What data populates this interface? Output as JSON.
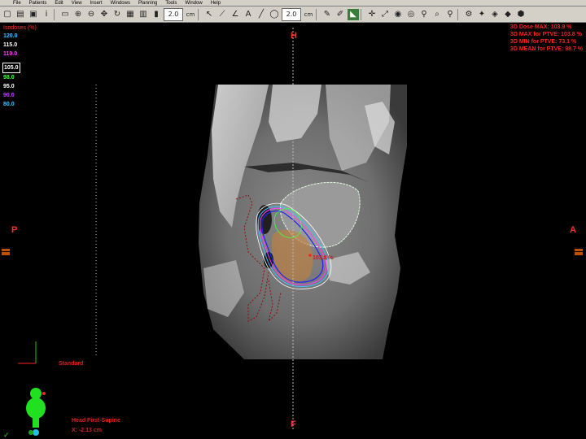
{
  "menu": [
    "File",
    "Patients",
    "Edit",
    "View",
    "Insert",
    "Windows",
    "Planning",
    "Tools",
    "Window",
    "Help"
  ],
  "toolbar": {
    "zoom_value_1": "2.0",
    "zoom_value_2": "2.0",
    "unit_1": "cm",
    "unit_2": "cm"
  },
  "isodose": {
    "title": "Isodoses (%)",
    "levels": [
      {
        "value": "120.0",
        "color": "#40c0ff"
      },
      {
        "value": "115.0",
        "color": "#ffffff"
      },
      {
        "value": "110.0",
        "color": "#ff40ff"
      },
      {
        "value": "105.0",
        "color": "#ffffff"
      },
      {
        "value": "98.0",
        "color": "#40ff40"
      },
      {
        "value": "95.0",
        "color": "#ffffff"
      },
      {
        "value": "90.0",
        "color": "#c040ff"
      },
      {
        "value": "80.0",
        "color": "#40c0ff"
      }
    ]
  },
  "dose_stats": [
    "3D Dose MAX: 103.9 %",
    "3D MAX for PTVE: 103.8 %",
    "3D MIN for PTVE: 73.1 %",
    "3D MEAN for PTVE: 98.7 %"
  ],
  "orientation": {
    "top": "H",
    "bottom": "F",
    "left": "P",
    "right": "A"
  },
  "view_mode": "Standard",
  "patient_position": "Head First-Supine",
  "slice_coord": "X: -2.13 cm",
  "max_point_label": "103.8 %",
  "colors": {
    "background": "#000000",
    "accent_red": "#ff2020",
    "menu_bg": "#d4d0c8"
  }
}
